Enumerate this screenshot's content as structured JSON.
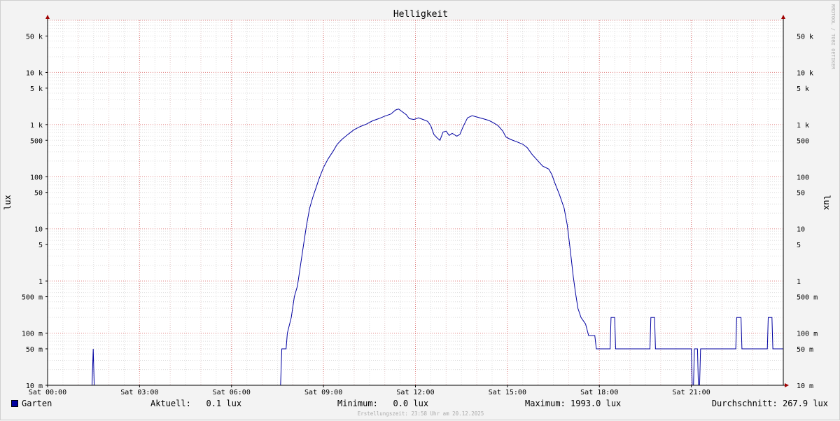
{
  "chart_data": {
    "type": "line",
    "title": "Helligkeit",
    "ylabel": "lux",
    "yscale": "log",
    "ylim": [
      0.01,
      100000
    ],
    "xlim": [
      "00:00",
      "24:00"
    ],
    "x_ticks": [
      {
        "label": "Sat 00:00",
        "hour": 0
      },
      {
        "label": "Sat 03:00",
        "hour": 3
      },
      {
        "label": "Sat 06:00",
        "hour": 6
      },
      {
        "label": "Sat 09:00",
        "hour": 9
      },
      {
        "label": "Sat 12:00",
        "hour": 12
      },
      {
        "label": "Sat 15:00",
        "hour": 15
      },
      {
        "label": "Sat 18:00",
        "hour": 18
      },
      {
        "label": "Sat 21:00",
        "hour": 21
      }
    ],
    "y_ticks": [
      {
        "label": "50 k",
        "value": 50000
      },
      {
        "label": "10 k",
        "value": 10000
      },
      {
        "label": "5 k",
        "value": 5000
      },
      {
        "label": "1 k",
        "value": 1000
      },
      {
        "label": "500",
        "value": 500
      },
      {
        "label": "100",
        "value": 100
      },
      {
        "label": "50",
        "value": 50
      },
      {
        "label": "10",
        "value": 10
      },
      {
        "label": "5",
        "value": 5
      },
      {
        "label": "1",
        "value": 1
      },
      {
        "label": "500 m",
        "value": 0.5
      },
      {
        "label": "100 m",
        "value": 0.1
      },
      {
        "label": "50 m",
        "value": 0.05
      },
      {
        "label": "10 m",
        "value": 0.01
      }
    ],
    "grid": true,
    "legend_position": "bottom-left",
    "series": [
      {
        "name": "Garten",
        "color": "#0000a0",
        "points": [
          [
            0,
            0.01
          ],
          [
            1.45,
            0.01
          ],
          [
            1.49,
            0.05
          ],
          [
            1.52,
            0.01
          ],
          [
            7.6,
            0.01
          ],
          [
            7.64,
            0.05
          ],
          [
            7.78,
            0.05
          ],
          [
            7.82,
            0.1
          ],
          [
            7.95,
            0.2
          ],
          [
            8.05,
            0.5
          ],
          [
            8.15,
            0.8
          ],
          [
            8.25,
            2
          ],
          [
            8.35,
            5
          ],
          [
            8.45,
            12
          ],
          [
            8.55,
            25
          ],
          [
            8.65,
            40
          ],
          [
            8.75,
            60
          ],
          [
            8.85,
            90
          ],
          [
            9.0,
            150
          ],
          [
            9.15,
            220
          ],
          [
            9.3,
            300
          ],
          [
            9.45,
            420
          ],
          [
            9.6,
            520
          ],
          [
            9.8,
            650
          ],
          [
            10.0,
            800
          ],
          [
            10.2,
            920
          ],
          [
            10.4,
            1020
          ],
          [
            10.6,
            1180
          ],
          [
            10.8,
            1300
          ],
          [
            11.0,
            1450
          ],
          [
            11.2,
            1600
          ],
          [
            11.35,
            1900
          ],
          [
            11.45,
            1993
          ],
          [
            11.55,
            1800
          ],
          [
            11.7,
            1550
          ],
          [
            11.8,
            1300
          ],
          [
            11.95,
            1250
          ],
          [
            12.1,
            1350
          ],
          [
            12.25,
            1250
          ],
          [
            12.4,
            1150
          ],
          [
            12.5,
            950
          ],
          [
            12.6,
            650
          ],
          [
            12.7,
            560
          ],
          [
            12.8,
            500
          ],
          [
            12.9,
            720
          ],
          [
            13.0,
            750
          ],
          [
            13.1,
            620
          ],
          [
            13.2,
            680
          ],
          [
            13.35,
            600
          ],
          [
            13.45,
            650
          ],
          [
            13.55,
            900
          ],
          [
            13.7,
            1350
          ],
          [
            13.85,
            1480
          ],
          [
            14.0,
            1400
          ],
          [
            14.2,
            1300
          ],
          [
            14.4,
            1200
          ],
          [
            14.55,
            1080
          ],
          [
            14.7,
            950
          ],
          [
            14.85,
            750
          ],
          [
            14.95,
            580
          ],
          [
            15.1,
            520
          ],
          [
            15.3,
            470
          ],
          [
            15.5,
            420
          ],
          [
            15.65,
            360
          ],
          [
            15.8,
            270
          ],
          [
            16.0,
            200
          ],
          [
            16.15,
            160
          ],
          [
            16.35,
            140
          ],
          [
            16.45,
            110
          ],
          [
            16.55,
            75
          ],
          [
            16.7,
            45
          ],
          [
            16.85,
            25
          ],
          [
            16.95,
            12
          ],
          [
            17.05,
            4
          ],
          [
            17.15,
            1.2
          ],
          [
            17.22,
            0.6
          ],
          [
            17.3,
            0.3
          ],
          [
            17.4,
            0.2
          ],
          [
            17.55,
            0.15
          ],
          [
            17.65,
            0.09
          ],
          [
            17.85,
            0.09
          ],
          [
            17.9,
            0.05
          ],
          [
            18.35,
            0.05
          ],
          [
            18.38,
            0.2
          ],
          [
            18.5,
            0.2
          ],
          [
            18.53,
            0.05
          ],
          [
            19.65,
            0.05
          ],
          [
            19.68,
            0.2
          ],
          [
            19.8,
            0.2
          ],
          [
            19.83,
            0.05
          ],
          [
            21.0,
            0.05
          ],
          [
            21.03,
            0.01
          ],
          [
            21.07,
            0.01
          ],
          [
            21.1,
            0.05
          ],
          [
            21.2,
            0.05
          ],
          [
            21.23,
            0.01
          ],
          [
            21.27,
            0.01
          ],
          [
            21.3,
            0.05
          ],
          [
            22.45,
            0.05
          ],
          [
            22.48,
            0.2
          ],
          [
            22.62,
            0.2
          ],
          [
            22.65,
            0.05
          ],
          [
            23.48,
            0.05
          ],
          [
            23.51,
            0.2
          ],
          [
            23.63,
            0.2
          ],
          [
            23.66,
            0.05
          ],
          [
            24.0,
            0.05
          ]
        ]
      }
    ]
  },
  "legend": {
    "series_name": "Garten",
    "current": "Aktuell:   0.1 lux",
    "minimum": "Minimum:   0.0 lux",
    "maximum": "Maximum: 1993.0 lux",
    "average": "Durchschnitt: 267.9 lux"
  },
  "created": "Erstellungszeit: 23:58 Uhr am 20.12.2025",
  "watermark": "RRDTOOL / TOBI OETIKER"
}
